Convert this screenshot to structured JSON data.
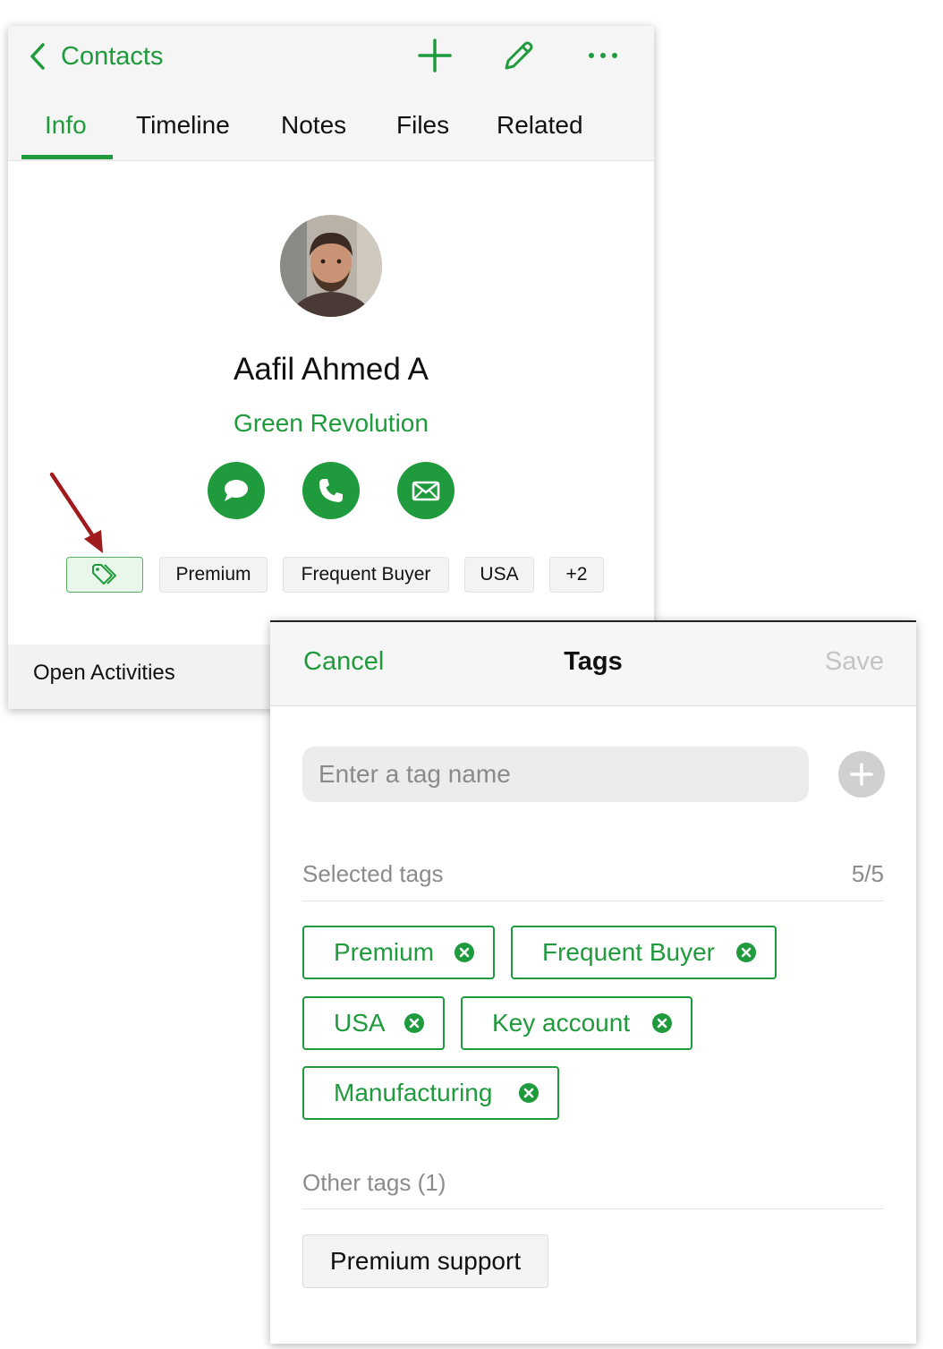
{
  "contact_screen": {
    "header": {
      "back_label": "Contacts"
    },
    "toolbar_icons": [
      "plus-icon",
      "pencil-icon",
      "more-icon"
    ],
    "tabs": [
      {
        "label": "Info",
        "active": true
      },
      {
        "label": "Timeline",
        "active": false
      },
      {
        "label": "Notes",
        "active": false
      },
      {
        "label": "Files",
        "active": false
      },
      {
        "label": "Related",
        "active": false
      }
    ],
    "contact": {
      "name": "Aafil Ahmed A",
      "company": "Green Revolution"
    },
    "actions": [
      "message-icon",
      "phone-icon",
      "email-icon"
    ],
    "tags": [
      "Premium",
      "Frequent Buyer",
      "USA"
    ],
    "more_tags": "+2",
    "section": "Open Activities"
  },
  "tags_sheet": {
    "cancel_label": "Cancel",
    "title": "Tags",
    "save_label": "Save",
    "input_placeholder": "Enter a tag name",
    "selected_label": "Selected tags",
    "selected_count": "5/5",
    "selected_tags": [
      "Premium",
      "Frequent Buyer",
      "USA",
      "Key account",
      "Manufacturing"
    ],
    "other_label": "Other tags (1)",
    "other_tags": [
      "Premium support"
    ]
  },
  "colors": {
    "accent": "#1f9a3c",
    "muted": "#8b8b8b",
    "disabled": "#c4c4c4",
    "annotation_arrow": "#a01c1c"
  }
}
